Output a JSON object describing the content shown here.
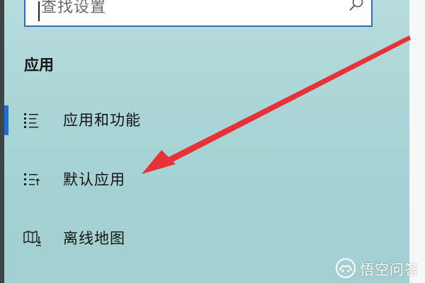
{
  "search": {
    "placeholder": "查找设置",
    "icon": "search-icon"
  },
  "section": {
    "title": "应用"
  },
  "nav": {
    "items": [
      {
        "label": "应用和功能",
        "icon": "list-icon",
        "selected": true
      },
      {
        "label": "默认应用",
        "icon": "list-arrow-icon",
        "selected": false
      },
      {
        "label": "离线地图",
        "icon": "map-download-icon",
        "selected": false
      }
    ]
  },
  "annotation": {
    "arrow_color": "#e8323a"
  },
  "watermark": {
    "text": "悟空问答",
    "logo": "wukong-logo-icon"
  },
  "colors": {
    "panel_background": "#aed7d8",
    "accent": "#1a6fd0",
    "search_border": "#2f6fb6"
  }
}
